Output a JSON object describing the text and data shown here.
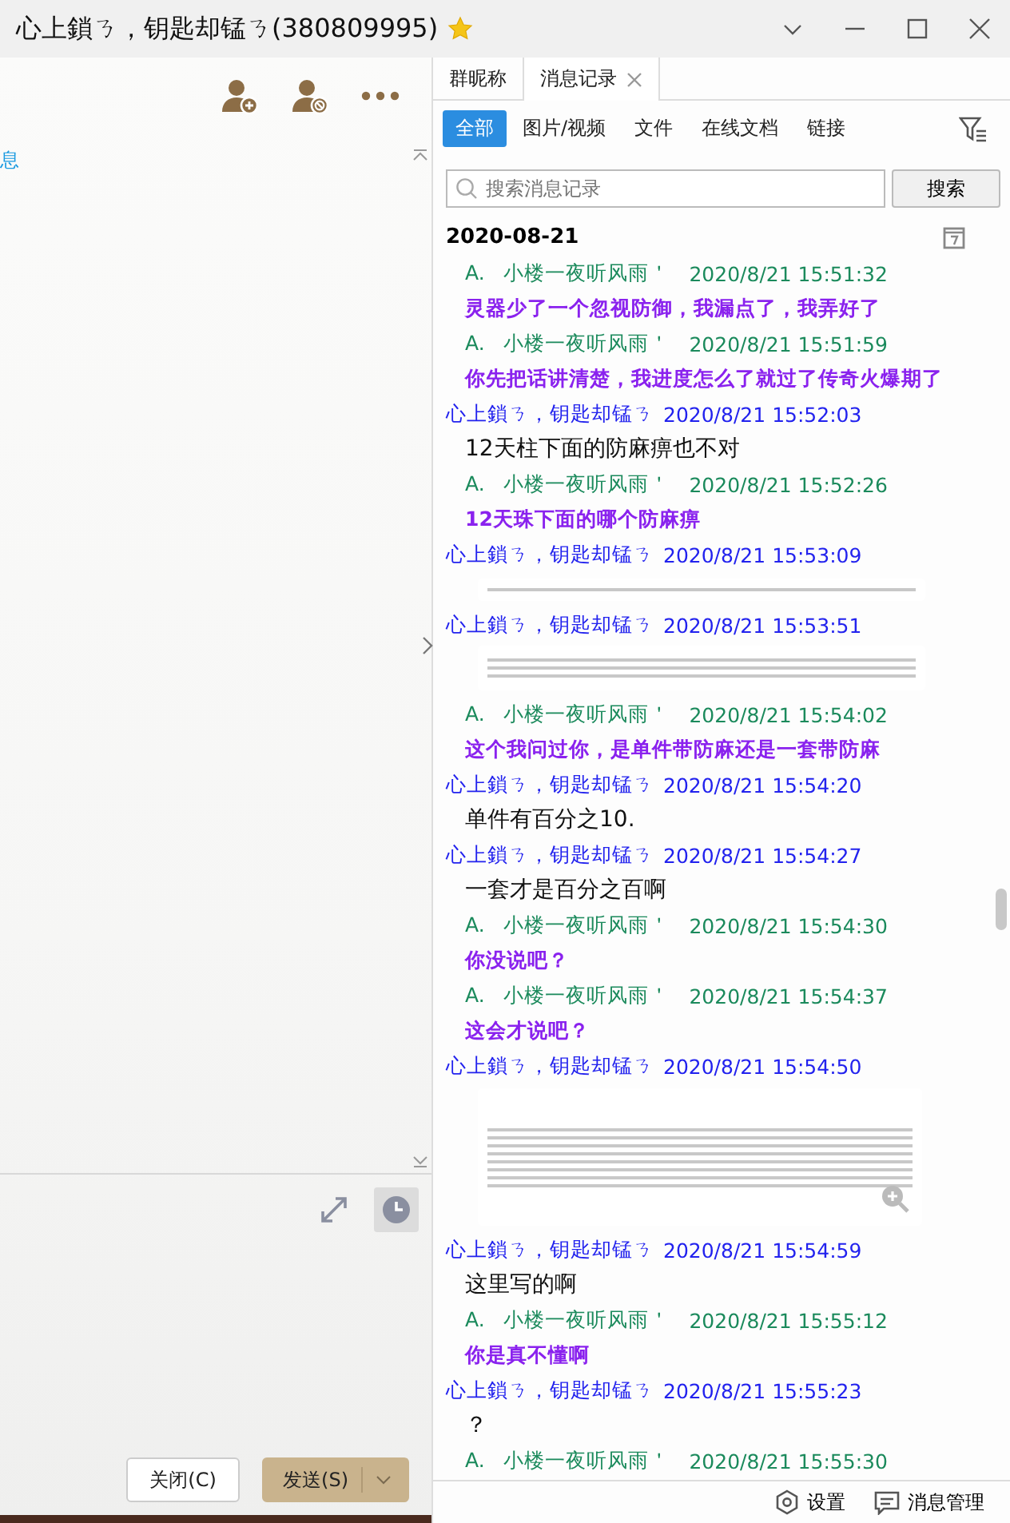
{
  "window": {
    "title": "心上鎖ㄋ，钥匙却锰ㄋ(380809995)"
  },
  "left_panel": {
    "notice": "息",
    "buttons": [
      {
        "label": "关闭(C)",
        "primary": false
      },
      {
        "label": "发送(S)",
        "primary": true
      }
    ]
  },
  "tabs": [
    {
      "label": "群昵称",
      "selected": false,
      "closable": false
    },
    {
      "label": "消息记录",
      "selected": true,
      "closable": true
    }
  ],
  "filters": [
    {
      "label": "全部",
      "selected": true
    },
    {
      "label": "图片/视频",
      "selected": false
    },
    {
      "label": "文件",
      "selected": false
    },
    {
      "label": "在线文档",
      "selected": false
    },
    {
      "label": "链接",
      "selected": false
    }
  ],
  "search": {
    "placeholder": "搜索消息记录",
    "button": "搜索"
  },
  "date": "2020-08-21",
  "messages": [
    {
      "mine": false,
      "sender": "A.   小楼一夜听风雨＇",
      "time": "2020/8/21 15:51:32",
      "kind": "text",
      "text": "灵器少了一个忽视防御，我漏点了，我弄好了"
    },
    {
      "mine": false,
      "sender": "A.   小楼一夜听风雨＇",
      "time": "2020/8/21 15:51:59",
      "kind": "text",
      "text": "你先把话讲清楚，我进度怎么了就过了传奇火爆期了"
    },
    {
      "mine": true,
      "sender": "心上鎖ㄋ，钥匙却锰ㄋ",
      "time": "2020/8/21 15:52:03",
      "kind": "text",
      "text": "12天柱下面的防麻痹也不对"
    },
    {
      "mine": false,
      "sender": "A.   小楼一夜听风雨＇",
      "time": "2020/8/21 15:52:26",
      "kind": "text",
      "text": "12天珠下面的哪个防麻痹"
    },
    {
      "mine": true,
      "sender": "心上鎖ㄋ，钥匙却锰ㄋ",
      "time": "2020/8/21 15:53:09",
      "kind": "strip"
    },
    {
      "mine": true,
      "sender": "心上鎖ㄋ，钥匙却锰ㄋ",
      "time": "2020/8/21 15:53:51",
      "kind": "block"
    },
    {
      "mine": false,
      "sender": "A.   小楼一夜听风雨＇",
      "time": "2020/8/21 15:54:02",
      "kind": "text",
      "text": "这个我问过你，是单件带防麻还是一套带防麻"
    },
    {
      "mine": true,
      "sender": "心上鎖ㄋ，钥匙却锰ㄋ",
      "time": "2020/8/21 15:54:20",
      "kind": "text",
      "text": "单件有百分之10."
    },
    {
      "mine": true,
      "sender": "心上鎖ㄋ，钥匙却锰ㄋ",
      "time": "2020/8/21 15:54:27",
      "kind": "text",
      "text": "一套才是百分之百啊"
    },
    {
      "mine": false,
      "sender": "A.   小楼一夜听风雨＇",
      "time": "2020/8/21 15:54:30",
      "kind": "text",
      "text": "你没说吧？"
    },
    {
      "mine": false,
      "sender": "A.   小楼一夜听风雨＇",
      "time": "2020/8/21 15:54:37",
      "kind": "text",
      "text": "这会才说吧？"
    },
    {
      "mine": true,
      "sender": "心上鎖ㄋ，钥匙却锰ㄋ",
      "time": "2020/8/21 15:54:50",
      "kind": "image"
    },
    {
      "mine": true,
      "sender": "心上鎖ㄋ，钥匙却锰ㄋ",
      "time": "2020/8/21 15:54:59",
      "kind": "text",
      "text": "这里写的啊"
    },
    {
      "mine": false,
      "sender": "A.   小楼一夜听风雨＇",
      "time": "2020/8/21 15:55:12",
      "kind": "text",
      "text": "你是真不懂啊"
    },
    {
      "mine": true,
      "sender": "心上鎖ㄋ，钥匙却锰ㄋ",
      "time": "2020/8/21 15:55:23",
      "kind": "text",
      "text": "？"
    },
    {
      "mine": false,
      "sender": "A.   小楼一夜听风雨＇",
      "time": "2020/8/21 15:55:30"
    }
  ],
  "footer": {
    "settings": "设置",
    "manage": "消息管理"
  }
}
